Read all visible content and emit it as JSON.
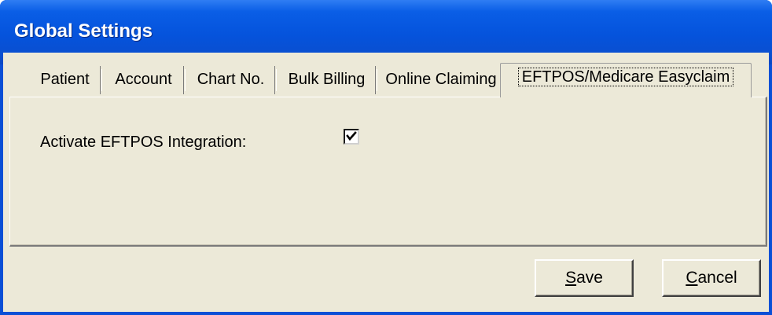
{
  "window": {
    "title": "Global Settings"
  },
  "tabs": [
    {
      "label": "Patient",
      "active": false
    },
    {
      "label": "Account",
      "active": false
    },
    {
      "label": "Chart No.",
      "active": false
    },
    {
      "label": "Bulk Billing",
      "active": false
    },
    {
      "label": "Online Claiming",
      "active": false
    },
    {
      "label": "EFTPOS/Medicare Easyclaim",
      "active": true
    }
  ],
  "panel": {
    "activate_eftpos_label": "Activate EFTPOS Integration:",
    "activate_eftpos_checked": true
  },
  "buttons": {
    "save": {
      "mnemonic": "S",
      "rest": "ave"
    },
    "cancel": {
      "mnemonic": "C",
      "rest": "ancel"
    }
  },
  "colors": {
    "titlebar": "#0553dc",
    "face": "#ece9d8"
  }
}
